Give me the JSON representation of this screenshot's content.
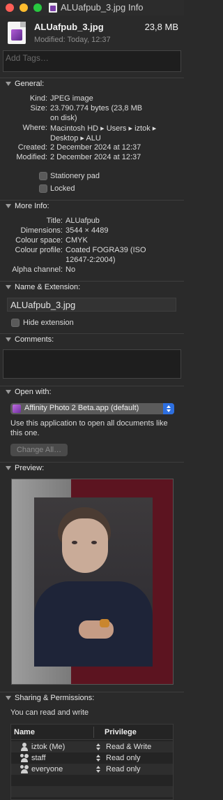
{
  "window": {
    "title": "ALUafpub_3.jpg Info"
  },
  "header": {
    "file_name": "ALUafpub_3.jpg",
    "file_size": "23,8 MB",
    "modified": "Modified: Today, 12:37",
    "icon": "affinity-photo-document-icon"
  },
  "tags": {
    "placeholder": "Add Tags…"
  },
  "general": {
    "title": "General:",
    "kind_label": "Kind:",
    "kind": "JPEG image",
    "size_label": "Size:",
    "size_line1": "23.790.774 bytes (23,8 MB",
    "size_line2": "on disk)",
    "where_label": "Where:",
    "where_line1": "Macintosh HD ▸ Users ▸ iztok ▸",
    "where_line2": "Desktop ▸ ALU",
    "created_label": "Created:",
    "created": "2 December 2024 at 12:37",
    "modified_label": "Modified:",
    "modified": "2 December 2024 at 12:37",
    "stationery_label": "Stationery pad",
    "stationery_checked": false,
    "locked_label": "Locked",
    "locked_checked": false
  },
  "more_info": {
    "title": "More Info:",
    "title_label": "Title:",
    "title_value": "ALUafpub",
    "dimensions_label": "Dimensions:",
    "dimensions": "3544 × 4489",
    "colour_space_label": "Colour space:",
    "colour_space": "CMYK",
    "colour_profile_label": "Colour profile:",
    "colour_profile_line1": "Coated FOGRA39 (ISO",
    "colour_profile_line2": "12647-2:2004)",
    "alpha_label": "Alpha channel:",
    "alpha": "No"
  },
  "name_ext": {
    "title": "Name & Extension:",
    "value": "ALUafpub_3.jpg",
    "hide_label": "Hide extension",
    "hide_checked": false
  },
  "comments": {
    "title": "Comments:",
    "value": ""
  },
  "open_with": {
    "title": "Open with:",
    "app": "Affinity Photo 2 Beta.app (default)",
    "note": "Use this application to open all documents like this one.",
    "change_all": "Change All…"
  },
  "preview": {
    "title": "Preview:"
  },
  "sharing": {
    "title": "Sharing & Permissions:",
    "note": "You can read and write",
    "col_name": "Name",
    "col_privilege": "Privilege",
    "rows": [
      {
        "name": "iztok (Me)",
        "privilege": "Read & Write",
        "icon": "user-icon"
      },
      {
        "name": "staff",
        "privilege": "Read only",
        "icon": "group-icon"
      },
      {
        "name": "everyone",
        "privilege": "Read only",
        "icon": "group-icon"
      }
    ]
  }
}
